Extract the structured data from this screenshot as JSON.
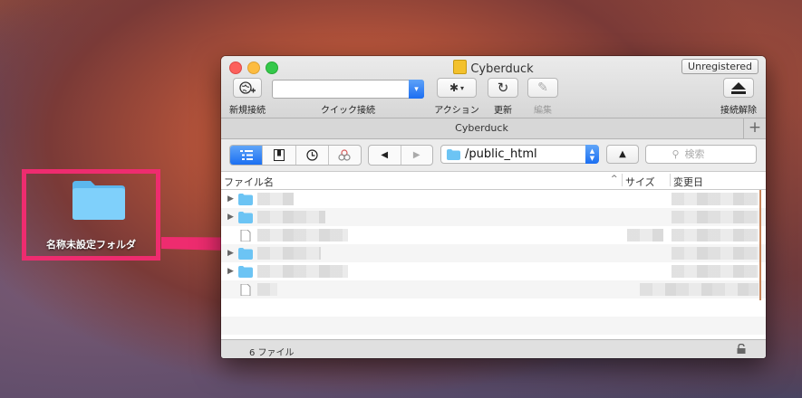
{
  "desktop": {
    "folder_label": "名称未設定フォルダ"
  },
  "window": {
    "title": "Cyberduck",
    "unregistered_label": "Unregistered",
    "toolbar": {
      "new_connection": "新規接続",
      "quick_connect": "クイック接続",
      "quick_connect_value": "",
      "action": "アクション",
      "refresh": "更新",
      "edit": "編集",
      "disconnect": "接続解除"
    },
    "tab_title": "Cyberduck",
    "nav": {
      "path": "/public_html",
      "search_placeholder": "検索"
    },
    "columns": {
      "filename": "ファイル名",
      "size": "サイズ",
      "modified": "変更日"
    },
    "rows": [
      {
        "kind": "folder"
      },
      {
        "kind": "folder"
      },
      {
        "kind": "file"
      },
      {
        "kind": "folder"
      },
      {
        "kind": "folder"
      },
      {
        "kind": "file"
      }
    ],
    "status": {
      "file_count": "6 ファイル"
    }
  },
  "colors": {
    "highlight_border": "#ee2c6f",
    "accent_blue": "#1b6ff2",
    "folder_blue": "#6cc4f4"
  }
}
